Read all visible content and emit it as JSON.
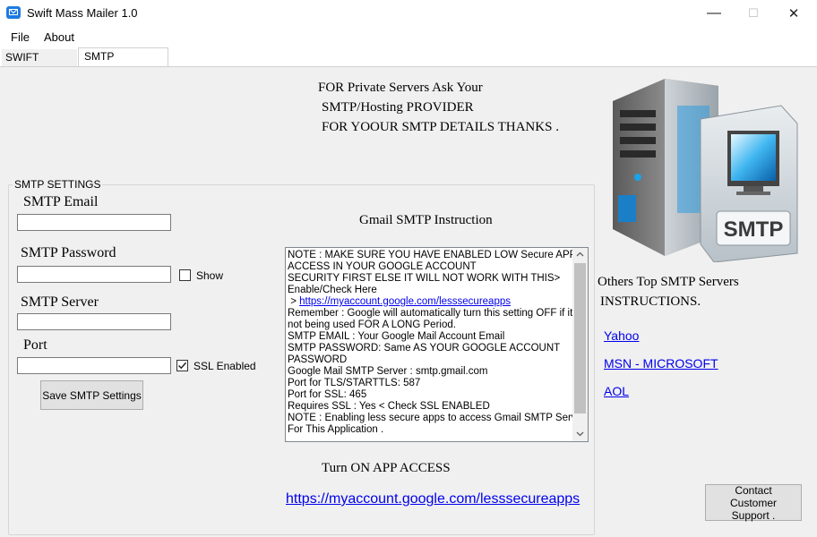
{
  "window": {
    "title": "Swift Mass Mailer 1.0",
    "minimize": "—",
    "maximize": "☐",
    "close": "✕"
  },
  "menu": {
    "file": "File",
    "about": "About"
  },
  "tabs": [
    {
      "label": "SWIFT MAILER"
    },
    {
      "label": "SMTP SETTINGS"
    }
  ],
  "notice": {
    "line1": "FOR Private Servers Ask Your",
    "line2": "SMTP/Hosting PROVIDER",
    "line3": "FOR YOOUR SMTP DETAILS THANKS ."
  },
  "smtp": {
    "group_title": "SMTP SETTINGS",
    "email_label": "SMTP Email",
    "email_value": "",
    "password_label": "SMTP Password",
    "password_value": "",
    "show_label": "Show",
    "server_label": "SMTP Server",
    "server_value": "",
    "port_label": "Port",
    "port_value": "",
    "ssl_label": "SSL Enabled",
    "ssl_checked": true,
    "save_button": "Save SMTP Settings"
  },
  "gmail": {
    "title": "Gmail SMTP Instruction",
    "lines": [
      "NOTE : MAKE SURE YOU HAVE ENABLED LOW Secure APPS",
      "ACCESS IN YOUR GOOGLE ACCOUNT",
      "SECURITY FIRST ELSE IT WILL NOT WORK WITH THIS>",
      "Enable/Check Here"
    ],
    "link_prefix": " > ",
    "link": "https://myaccount.google.com/lesssecureapps",
    "lines2": [
      "Remember :  Google will automatically turn this setting OFF if it’s",
      "not being used FOR A LONG Period.",
      "SMTP EMAIL : Your Google Mail Account Email",
      "SMTP PASSWORD: Same AS YOUR GOOGLE ACCOUNT",
      "PASSWORD",
      "Google Mail SMTP Server  : smtp.gmail.com",
      "Port for TLS/STARTTLS: 587",
      "Port for SSL: 465",
      "Requires SSL : Yes < Check SSL ENABLED",
      "NOTE : Enabling less secure apps to access Gmail SMTP Server",
      "For This Application ."
    ],
    "turn_on_label": "Turn ON APP ACCESS",
    "turn_on_link": "https://myaccount.google.com/lesssecureapps"
  },
  "illustration": {
    "badge": "SMTP"
  },
  "others": {
    "line1": "Others Top SMTP Servers",
    "line2": "INSTRUCTIONS.",
    "yahoo": "Yahoo",
    "msn": "MSN - MICROSOFT",
    "aol": "AOL"
  },
  "support": {
    "button": "Contact Customer Support ."
  },
  "colors": {
    "link": "#0000ee",
    "panel": "#f0f0f0",
    "accent": "#1e7be0"
  }
}
